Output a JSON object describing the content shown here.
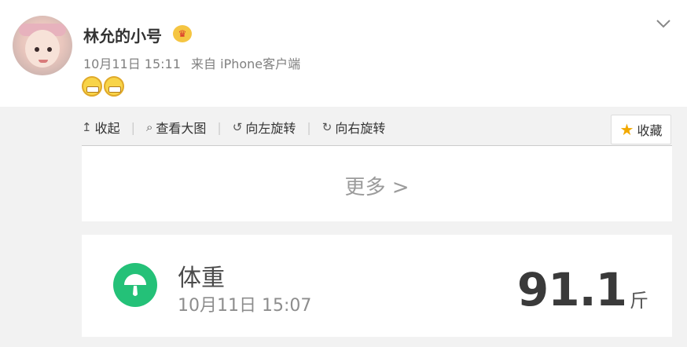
{
  "post": {
    "username": "林允的小号",
    "timestamp": "10月11日 15:11",
    "source_prefix": "来自",
    "source": "iPhone客户端",
    "vip_icon": "crown-badge-icon",
    "emoji_icon": "grin-emoji-icon"
  },
  "toolbar": {
    "collapse_label": "收起",
    "view_large_label": "查看大图",
    "rotate_left_label": "向左旋转",
    "rotate_right_label": "向右旋转",
    "favorite_label": "收藏"
  },
  "more": {
    "label": "更多 >"
  },
  "weight_card": {
    "title": "体重",
    "time": "10月11日 15:07",
    "value": "91.1",
    "unit": "斤",
    "accent_color": "#24c178"
  }
}
